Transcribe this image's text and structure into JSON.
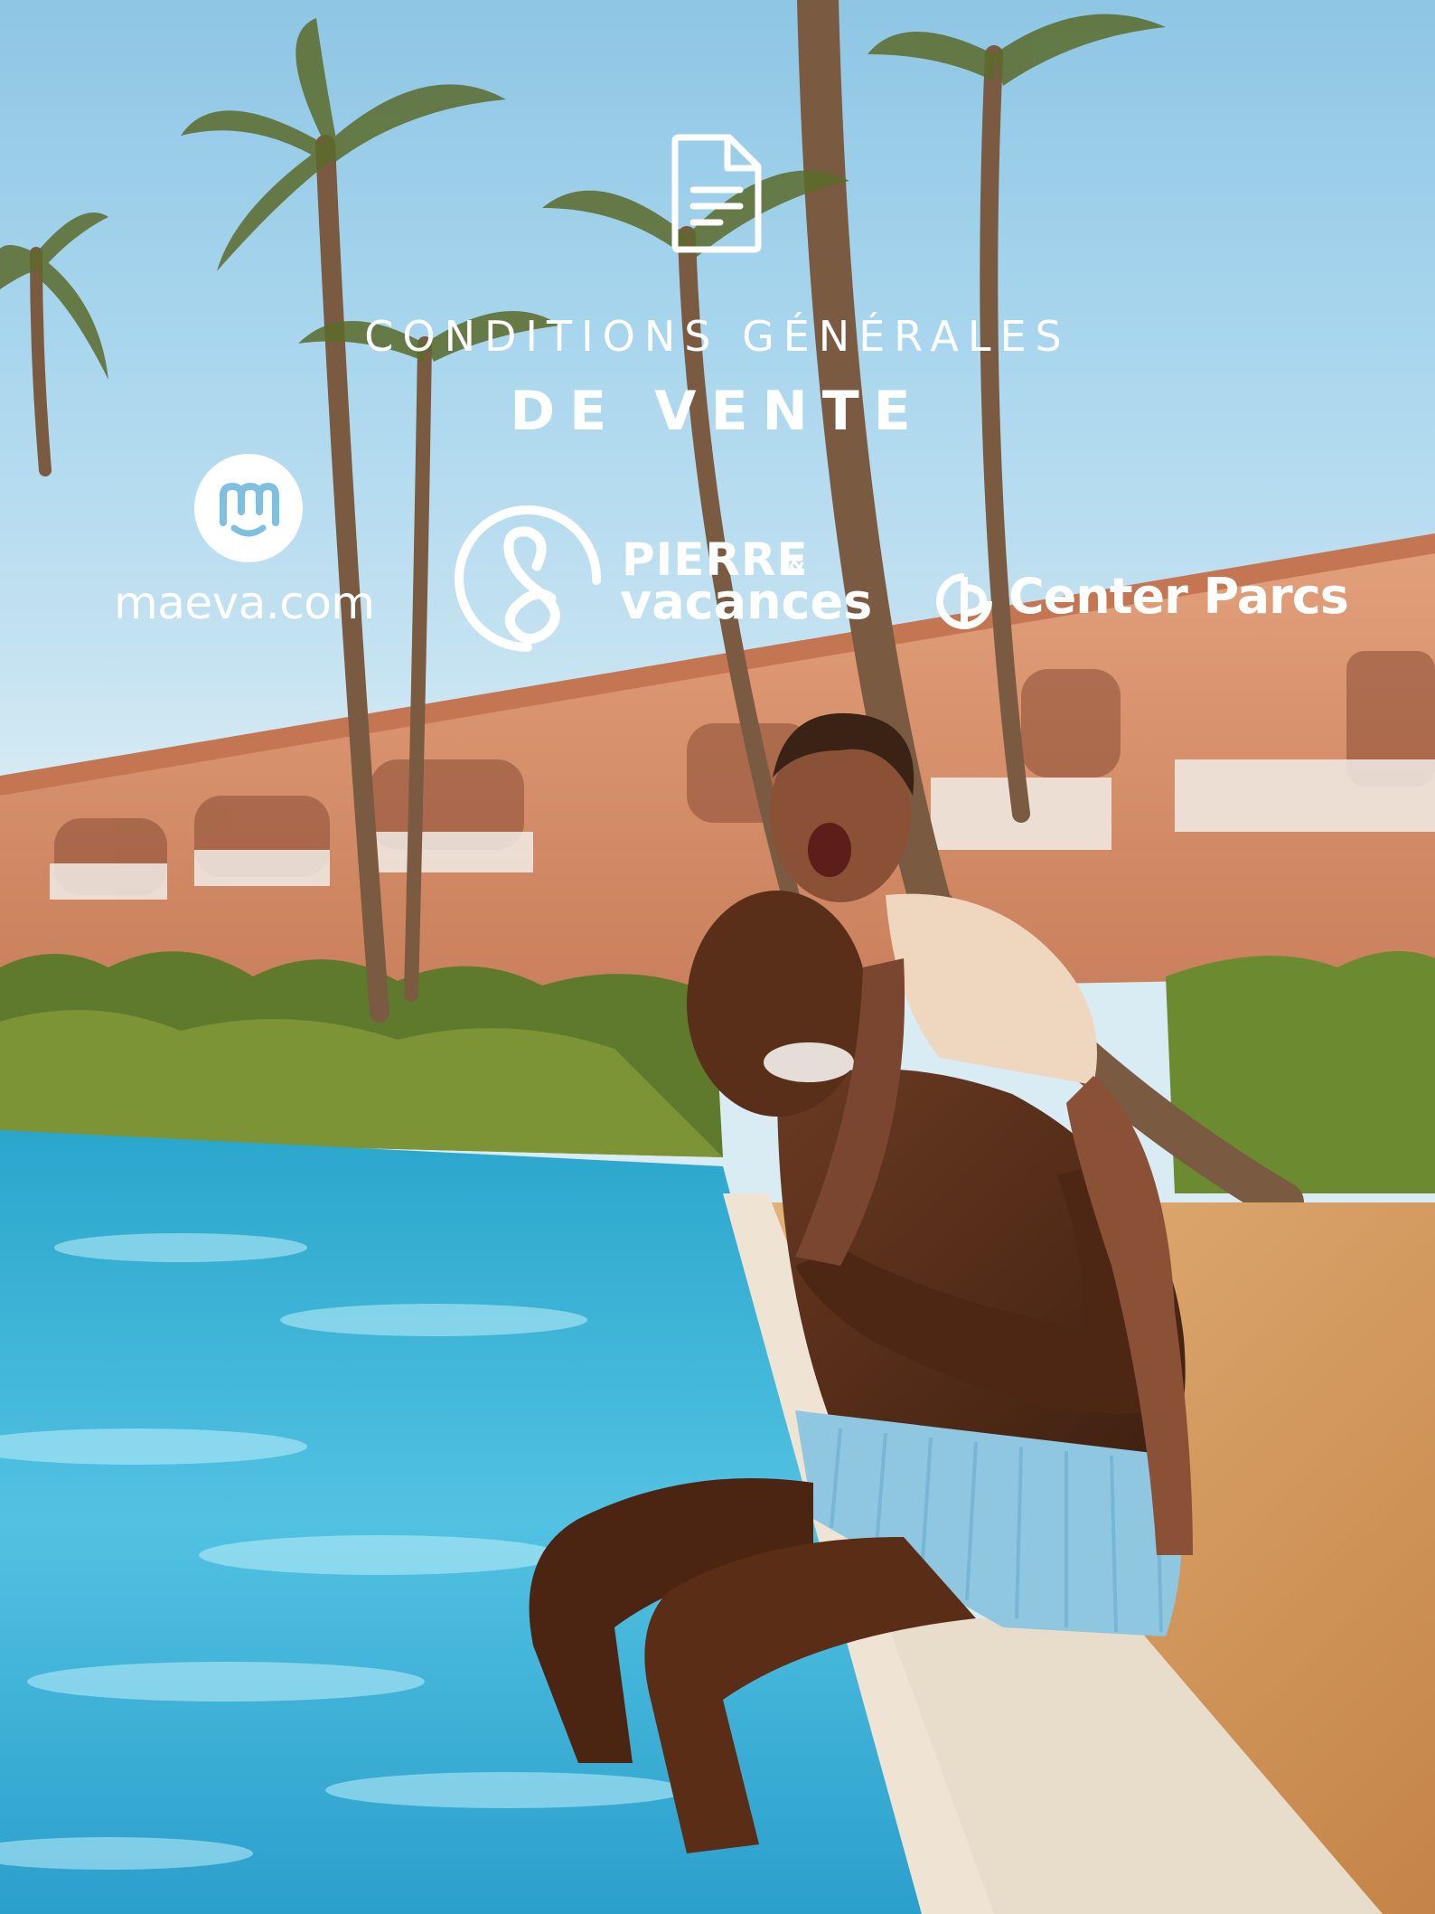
{
  "document": {
    "title_line1": "CONDITIONS GÉNÉRALES",
    "title_line2": "DE VENTE",
    "icon": "document-icon"
  },
  "brands": [
    {
      "name": "maeva.com",
      "icon": "maeva-logo"
    },
    {
      "name_line1": "PIERRE",
      "ampersand": "&",
      "name_line2": "vacances",
      "icon": "pierre-vacances-logo"
    },
    {
      "name": "Center Parcs",
      "icon": "center-parcs-logo"
    }
  ],
  "photo": {
    "subject": "father and daughter laughing at the edge of a swimming pool"
  },
  "colors": {
    "sky": "#a9d6ee",
    "pool": "#3fb6d8",
    "building": "#d9906d",
    "text": "#ffffff"
  }
}
